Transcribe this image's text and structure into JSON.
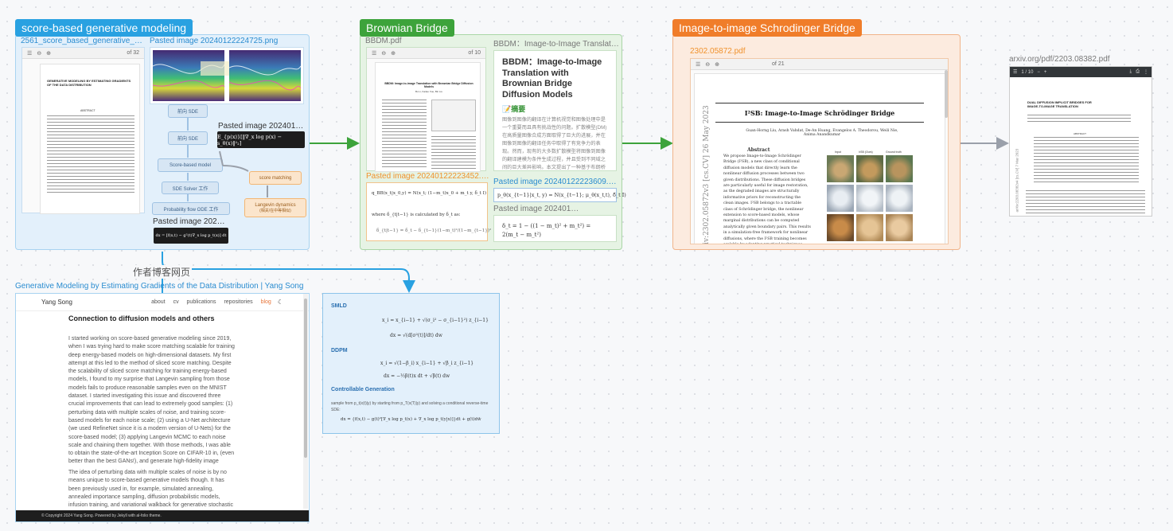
{
  "groups": {
    "score": {
      "title": "score-based generative modeling",
      "color": "#29a1e1"
    },
    "brownian": {
      "title": "Brownian Bridge",
      "color": "#3da33b"
    },
    "i2isb": {
      "title": "Image-to-image Schrodinger Bridge",
      "color": "#f07d2a"
    }
  },
  "score_cards": {
    "pdf_label": "2561_score_based_generative_mod...",
    "img1_label": "Pasted image 20240122224725.png",
    "img2_label": "Pasted image 20240123...",
    "img3_label": "Pasted image 20240...",
    "pdf_pager": "of 32",
    "pdf_title": "GENERATIVE MODELING BY ESTIMATING GRADIENTS OF THE DATA DISTRIBUTION",
    "pdf_section": "ABSTRACT",
    "eq1": "E_{p(x)}[‖∇_x log p(x) − s_θ(x)‖²₂]",
    "eq2": "dx = [f(x,t) − g²(t)∇_x log p_t(x)] dt"
  },
  "diagram_nodes": [
    "前向 SDE",
    "前向 SDE",
    "Score-based model",
    "SDE Solver 工作",
    "Probability flow ODE 工作",
    "score matching",
    "Langevin dynamics",
    "(相关/在中等相似)"
  ],
  "brownian_cards": {
    "pdf_label": "BBDM.pdf",
    "pager": "of 10",
    "web_label": "BBDM：Image-to-Image Translatio...",
    "web_title": "BBDM：Image-to-Image Translation with Brownian Bridge Diffusion Models",
    "web_section": "📝摘要",
    "web_text": "图像到图像的翻译在计算机视觉和图像处理中是一个重要而且具有挑战性的问题。扩散模型(DM)在高质量图像合成方面取得了巨大的进展，并在图像到图像的翻译任务中取得了有竞争力的表现。然而，现有的大多数扩散模型将图像到图像的翻译建模为条件生成过程，并且受到不同域之间的巨大差异影响。本文提出了一种基于布朗桥",
    "img1_label": "Pasted image 20240122223452.png",
    "img2_label": "Pasted image 20240122223609.png",
    "img3_label": "Pasted image 2024012...",
    "pdf_paper_title": "BBDM: Image-to-image Translation with Brownian Bridge Diffusion Models",
    "pdf_authors": "Bo Li, Kaitao Xue, Bin Liu",
    "eq_a": "q_BB(x_t|x_0,y) = N(x_t; (1−m_t)x_0 + m_t y, δ_t I)",
    "eq_a_where": "where δ_{t|t−1} is calculated by δ_t as:",
    "eq_a_delta": "δ_{t|t−1} = δ_t − δ_{t−1}(1−m_t)²/(1−m_{t−1})²",
    "eq_b": "p_θ(x_{t−1}|x_t, y) = N(x_{t−1}; μ_θ(x_t,t), δ̃_t I)",
    "eq_c": "δ_t = 1 − ((1 − m_t)² + m_t²) = 2(m_t − m_t²)"
  },
  "i2isb_cards": {
    "pdf_label": "2302.05872.pdf",
    "pager": "of 21",
    "paper_title": "I²SB: Image-to-Image Schrödinger Bridge",
    "authors": "Guan-Horng Liu, Arash Vahdat, De-An Huang, Evangelos A. Theodorou, Weili Nie, Anima Anandkumar",
    "abstract_heading": "Abstract",
    "abstract": "We propose Image-to-Image Schrödinger Bridge (I²SB), a new class of conditional diffusion models that directly learn the nonlinear diffusion processes between two given distributions. These diffusion bridges are particularly useful for image restoration, as the degraded images are structurally informative priors for reconstructing the clean images. I²SB belongs to a tractable class of Schrödinger bridge, the nonlinear extension to score-based models, whose marginal distributions can be computed analytically given boundary pairs. This results in a simulation-free framework for nonlinear diffusions, where the I²SB training becomes scalable by adopting practical techniques used in standard diffusion models. We validate I²SB in solving various image restoration",
    "arxiv_side": "arXiv:2302.05872v3 [cs.CV] 26 May 2023",
    "figure_cols": [
      "Input",
      "I²SB (Ours)",
      "Ground truth"
    ]
  },
  "arxiv_card": {
    "label": "arxiv.org/pdf/2203.08382.pdf",
    "pager": "1 / 10",
    "title": "DUAL DIFFUSION IMPLICIT BRIDGES FOR IMAGE-TO-IMAGE TRANSLATION",
    "section": "ABSTRACT",
    "side": "arXiv:2203.08382v4 [cs.CV] 7 Mar 2023"
  },
  "edge_label": "作者博客网页",
  "blog": {
    "label": "Generative Modeling by Estimating Gradients of the Data Distribution | Yang Song",
    "brand": "Yang Song",
    "nav": [
      "about",
      "cv",
      "publications",
      "repositories",
      "blog"
    ],
    "heading": "Connection to diffusion models and others",
    "para1": "I started working on score-based generative modeling since 2019, when I was trying hard to make score matching scalable for training deep energy-based models on high-dimensional datasets. My first attempt at this led to the method of sliced score matching. Despite the scalability of sliced score matching for training energy-based models, I found to my surprise that Langevin sampling from those models fails to produce reasonable samples even on the MNIST dataset. I started investigating this issue and discovered three crucial improvements that can lead to extremely good samples: (1) perturbing data with multiple scales of noise, and training score-based models for each noise scale; (2) using a U-Net architecture (we used RefineNet since it is a modern version of U-Nets) for the score-based model; (3) applying Langevin MCMC to each noise scale and chaining them together. With those methods, I was able to obtain the state-of-the-art Inception Score on CIFAR-10 in, (even better than the best GANs!), and generate high-fidelity image samples of resolution up to 256 × 256 in.",
    "para2": "The idea of perturbing data with multiple scales of noise is by no means unique to score-based generative models though. It has been previously used in, for example, simulated annealing, annealed importance sampling, diffusion probabilistic models, infusion training, and variational walkback for generative stochastic networks. Out of all these works, diffusion probabilistic",
    "footer": "© Copyright 2024 Yang Song. Powered by Jekyll with al-folio theme."
  },
  "formula": {
    "smld": "SMLD",
    "smld_eq1": "x_i = x_{i−1} + √(σ_i² − σ_{i−1}²) z_{i−1}",
    "smld_eq2": "dx = √(d[σ²(t)]/dt) dw",
    "ddpm": "DDPM",
    "ddpm_eq1": "x_i = √(1−β_i) x_{i−1} + √β_i z_{i−1}",
    "ddpm_eq2": "dx = −½β(t)x dt + √β(t) dw",
    "cg": "Controllable Generation",
    "cg_text": "sample from p_t(x(t)|y) by starting from p_T(x(T)|y) and solving a conditional reverse-time SDE:",
    "cg_eq": "dx = {f(x,t) − g(t)²[∇_x log p_t(x) + ∇_x log p_t(y|x)]}dt + g(t)dw̄"
  },
  "colors": {
    "blue": "#29a1e1",
    "green": "#3da33b",
    "orange": "#f07d2a",
    "edge_blue": "#29a1e1",
    "edge_green": "#3da33b",
    "edge_gray": "#9aa0aa"
  }
}
